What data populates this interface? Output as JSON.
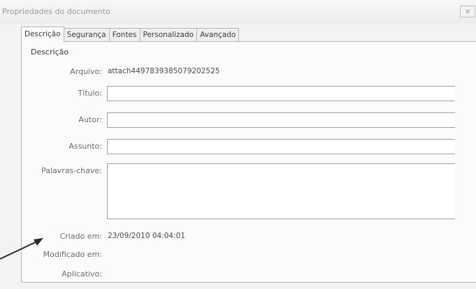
{
  "window": {
    "title": "Propriedades do documento",
    "close_label": "✕"
  },
  "tabs": [
    {
      "label": "Descrição",
      "active": true
    },
    {
      "label": "Segurança",
      "active": false
    },
    {
      "label": "Fontes",
      "active": false
    },
    {
      "label": "Personalizado",
      "active": false
    },
    {
      "label": "Avançado",
      "active": false
    }
  ],
  "description": {
    "group_label": "Descrição",
    "file_label": "Arquivo:",
    "file_value": "attach4497839385079202525",
    "title_label": "Título:",
    "title_value": "",
    "author_label": "Autor:",
    "author_value": "",
    "subject_label": "Assunto:",
    "subject_value": "",
    "keywords_label": "Palavras-chave:",
    "keywords_value": "",
    "created_label": "Criado em:",
    "created_value": "23/09/2010 04:04:01",
    "modified_label": "Modificado em:",
    "modified_value": "",
    "application_label": "Aplicativo:",
    "application_value": ""
  },
  "annotation": {
    "arrow_color": "#2a2a2a"
  }
}
